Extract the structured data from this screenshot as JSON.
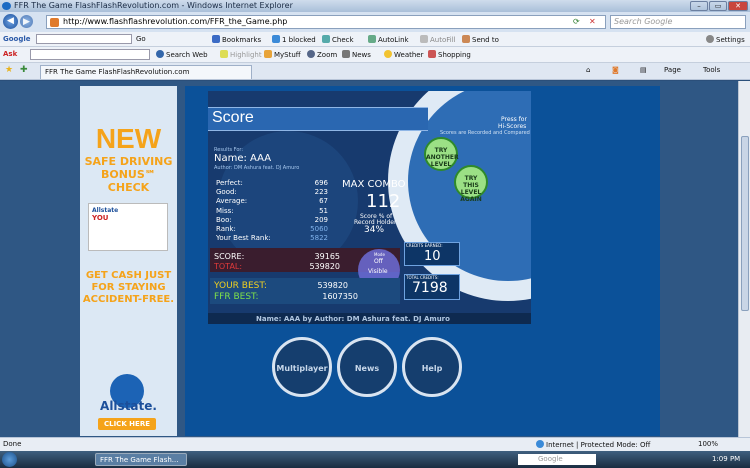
{
  "window": {
    "title": "FFR The Game FlashFlashRevolution.com - Windows Internet Explorer"
  },
  "address": {
    "url": "http://www.flashflashrevolution.com/FFR_the_Game.php",
    "search_placeholder": "Search Google"
  },
  "google_bar": {
    "label": "Google",
    "go": "Go",
    "bookmarks": "Bookmarks",
    "blocked": "1 blocked",
    "check": "Check",
    "autolink": "AutoLink",
    "autofill": "AutoFill",
    "send": "Send to",
    "settings": "Settings"
  },
  "ask_bar": {
    "label": "Ask",
    "search_web": "Search Web",
    "highlight": "Highlight",
    "mystuff": "MyStuff",
    "zoom": "Zoom",
    "news": "News",
    "weather": "Weather",
    "shopping": "Shopping"
  },
  "tab": {
    "label": "FFR The Game FlashFlashRevolution.com",
    "page": "Page",
    "tools": "Tools"
  },
  "ad": {
    "new": "NEW",
    "line1": "SAFE DRIVING",
    "line2": "BONUS℠ CHECK",
    "cash1": "GET CASH JUST",
    "cash2": "FOR STAYING",
    "cash3": "ACCIDENT-FREE.",
    "brand": "Allstate.",
    "click": "CLICK HERE",
    "check_payee": "YOU",
    "check_brand": "Allstate"
  },
  "score": {
    "title": "Score",
    "press": "Press for",
    "hiscores": "Hi-Scores",
    "recorded": "Scores are Recorded and Compared",
    "results_for": "Results For:",
    "name": "Name: AAA",
    "author": "Author: DM Ashura feat. DJ Amuro",
    "labels": [
      "Perfect:",
      "Good:",
      "Average:",
      "Miss:",
      "Boo:",
      "Rank:",
      "Your Best Rank:"
    ],
    "values": [
      "696",
      "223",
      "67",
      "51",
      "209",
      "5060",
      "5822"
    ],
    "max_combo_label": "MAX COMBO",
    "max_combo": "112",
    "record_label1": "Score % of",
    "record_label2": "Record Holder",
    "record_pct": "34%",
    "score_label": "SCORE:",
    "score_value": "39165",
    "total_label": "TOTAL:",
    "total_value": "539820",
    "your_best_label": "YOUR BEST:",
    "your_best_value": "539820",
    "ffr_best_label": "FFR BEST:",
    "ffr_best_value": "1607350",
    "try_another": "TRY ANOTHER LEVEL",
    "try_again": "TRY THIS LEVEL AGAIN",
    "credits_earned_label": "CREDITS EARNED:",
    "credits_earned": "10",
    "total_credits_label": "TOTAL CREDITS:",
    "total_credits": "7198",
    "toggle_top": "Off",
    "toggle_bottom": "Visible",
    "toggle_hdr": "Mode",
    "footer": "Name: AAA by Author: DM Ashura feat. DJ Amuro"
  },
  "buttons": [
    "Multiplayer",
    "News",
    "Help"
  ],
  "status": {
    "left": "Done",
    "zone": "Internet | Protected Mode: Off",
    "zoom": "100%"
  },
  "taskbar": {
    "task": "FFR The Game Flash...",
    "search": "Google",
    "clock": "1:09 PM"
  }
}
